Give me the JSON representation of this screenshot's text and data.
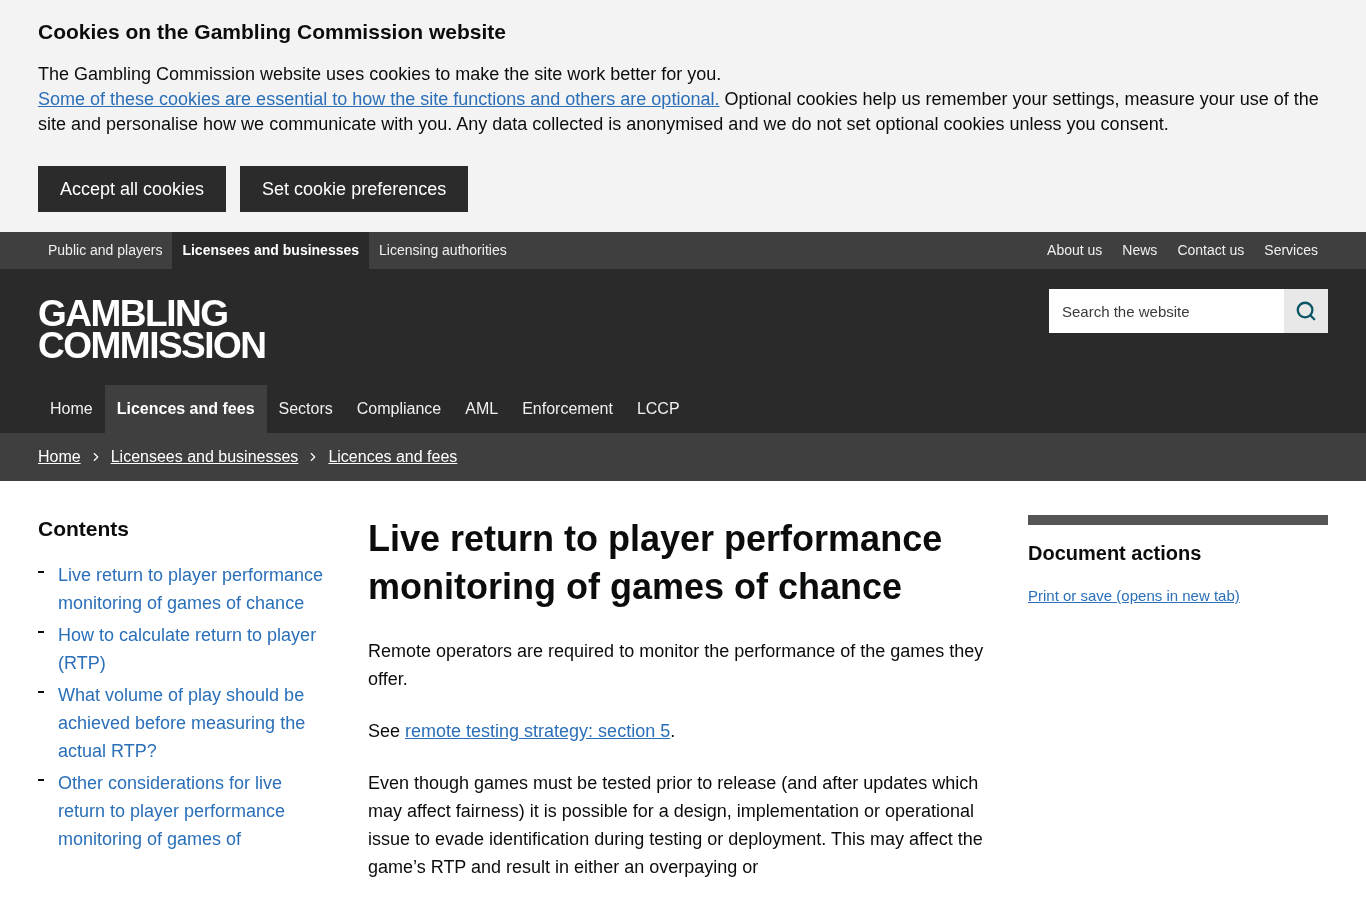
{
  "cookie_banner": {
    "title": "Cookies on the Gambling Commission website",
    "text_before": "The Gambling Commission website uses cookies to make the site work better for you. ",
    "link": "Some of these cookies are essential to how the site functions and others are optional.",
    "text_after": " Optional cookies help us remember your settings, measure your use of the site and personalise how we communicate with you. Any data collected is anonymised and we do not set optional cookies unless you consent.",
    "buttons": [
      "Accept all cookies",
      "Set cookie preferences"
    ]
  },
  "audience_nav": {
    "items": [
      {
        "label": "Public and players",
        "selected": false
      },
      {
        "label": "Licensees and businesses",
        "selected": true
      },
      {
        "label": "Licensing authorities",
        "selected": false
      }
    ],
    "utility_links": [
      "About us",
      "News",
      "Contact us",
      "Services"
    ]
  },
  "header": {
    "logo": [
      "GAMBLING",
      "COMMISSION"
    ],
    "search": {
      "placeholder": "Search the website"
    }
  },
  "main_nav": [
    {
      "label": "Home",
      "selected": false
    },
    {
      "label": "Licences and fees",
      "selected": true
    },
    {
      "label": "Sectors",
      "selected": false
    },
    {
      "label": "Compliance",
      "selected": false
    },
    {
      "label": "AML",
      "selected": false
    },
    {
      "label": "Enforcement",
      "selected": false
    },
    {
      "label": "LCCP",
      "selected": false
    }
  ],
  "breadcrumbs": [
    "Home",
    "Licensees and businesses",
    "Licences and fees"
  ],
  "contents": {
    "title": "Contents",
    "items": [
      "Live return to player performance monitoring of games of chance",
      "How to calculate return to player (RTP)",
      "What volume of play should be achieved before measuring the actual RTP?",
      "Other considerations for live return to player performance monitoring of games of"
    ]
  },
  "article": {
    "title": "Live return to player performance monitoring of games of chance",
    "intro": "Remote operators are required to monitor the performance of the games they offer.",
    "see": {
      "before": "See ",
      "link": "remote testing strategy: section 5",
      "after": "."
    },
    "body": "Even though games must be tested prior to release (and after updates which may affect fairness) it is possible for a design, implementation or operational issue to evade identification during testing or deployment. This may affect the game’s RTP and result in either an overpaying or"
  },
  "document_actions": {
    "title": "Document actions",
    "link": "Print or save (opens in new tab)"
  }
}
